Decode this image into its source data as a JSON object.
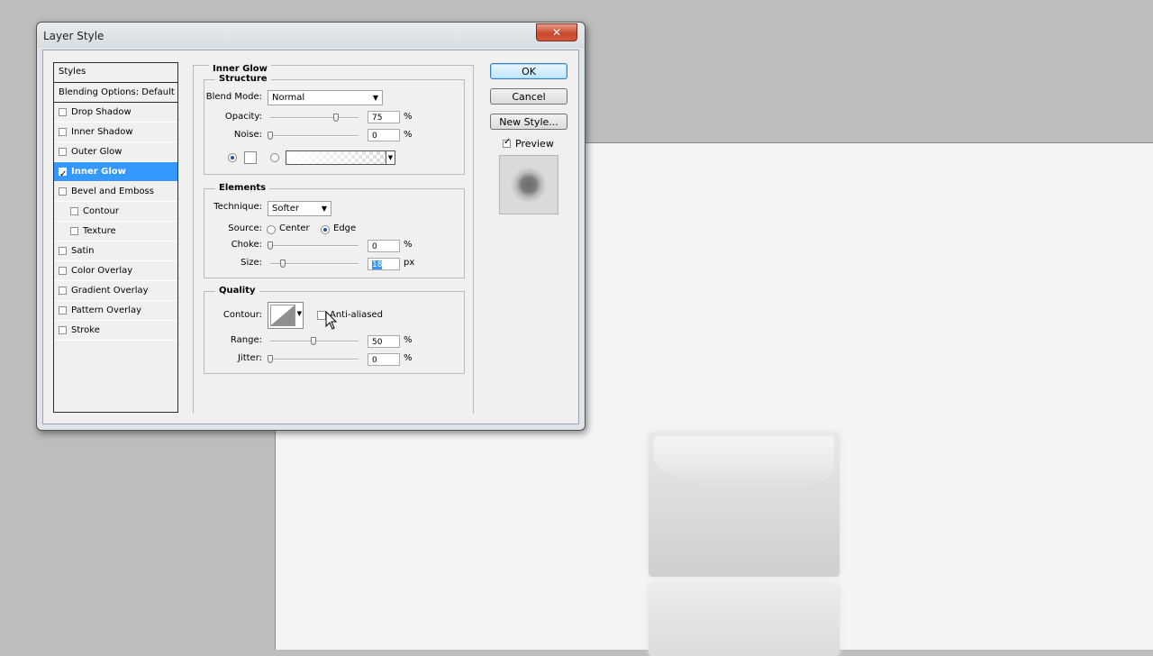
{
  "dialog": {
    "title": "Layer Style",
    "close_label": "✕"
  },
  "styles_list": {
    "header": "Styles",
    "blending": "Blending Options: Default",
    "items": [
      {
        "label": "Drop Shadow",
        "checked": false,
        "selected": false,
        "indent": false
      },
      {
        "label": "Inner Shadow",
        "checked": false,
        "selected": false,
        "indent": false
      },
      {
        "label": "Outer Glow",
        "checked": false,
        "selected": false,
        "indent": false
      },
      {
        "label": "Inner Glow",
        "checked": true,
        "selected": true,
        "indent": false
      },
      {
        "label": "Bevel and Emboss",
        "checked": false,
        "selected": false,
        "indent": false
      },
      {
        "label": "Contour",
        "checked": false,
        "selected": false,
        "indent": true
      },
      {
        "label": "Texture",
        "checked": false,
        "selected": false,
        "indent": true
      },
      {
        "label": "Satin",
        "checked": false,
        "selected": false,
        "indent": false
      },
      {
        "label": "Color Overlay",
        "checked": false,
        "selected": false,
        "indent": false
      },
      {
        "label": "Gradient Overlay",
        "checked": false,
        "selected": false,
        "indent": false
      },
      {
        "label": "Pattern Overlay",
        "checked": false,
        "selected": false,
        "indent": false
      },
      {
        "label": "Stroke",
        "checked": false,
        "selected": false,
        "indent": false
      }
    ]
  },
  "inner_glow": {
    "title": "Inner Glow",
    "structure": {
      "title": "Structure",
      "blend_mode_label": "Blend Mode:",
      "blend_mode_value": "Normal",
      "opacity_label": "Opacity:",
      "opacity_value": "75",
      "opacity_unit": "%",
      "noise_label": "Noise:",
      "noise_value": "0",
      "noise_unit": "%"
    },
    "elements": {
      "title": "Elements",
      "technique_label": "Technique:",
      "technique_value": "Softer",
      "source_label": "Source:",
      "source_center": "Center",
      "source_edge": "Edge",
      "choke_label": "Choke:",
      "choke_value": "0",
      "choke_unit": "%",
      "size_label": "Size:",
      "size_value": "18",
      "size_unit": "px"
    },
    "quality": {
      "title": "Quality",
      "contour_label": "Contour:",
      "anti_aliased_label": "Anti-aliased",
      "range_label": "Range:",
      "range_value": "50",
      "range_unit": "%",
      "jitter_label": "Jitter:",
      "jitter_value": "0",
      "jitter_unit": "%"
    }
  },
  "buttons": {
    "ok": "OK",
    "cancel": "Cancel",
    "new_style": "New Style...",
    "preview": "Preview"
  },
  "icons": {
    "close": "close-icon",
    "dropdown": "chevron-down-icon",
    "cursor": "mouse-pointer-icon"
  }
}
